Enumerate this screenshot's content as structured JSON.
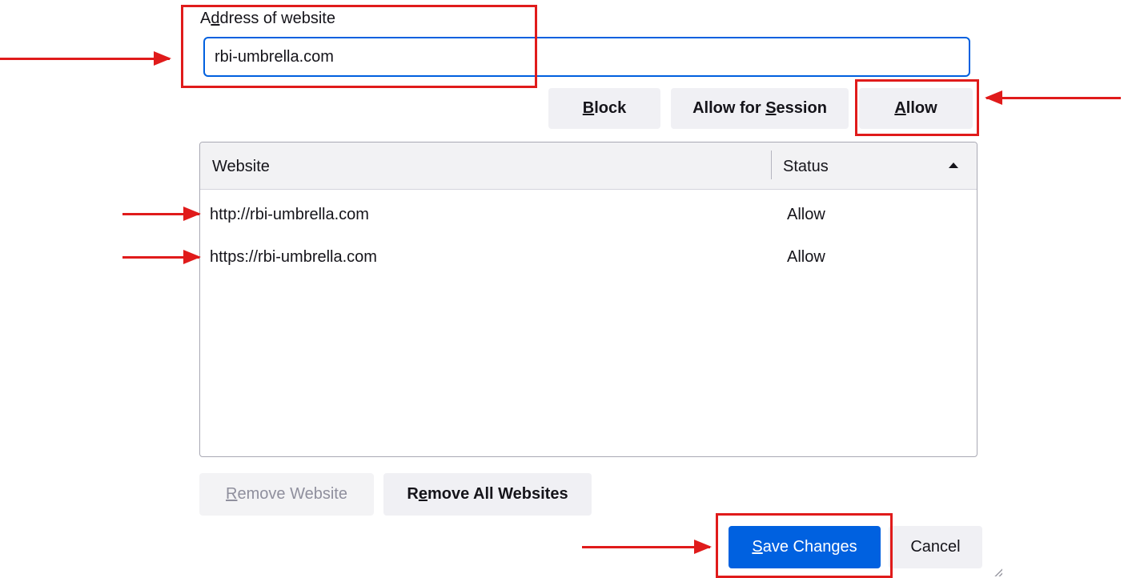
{
  "address": {
    "label_prefix": "A",
    "label_access": "d",
    "label_rest": "dress of website",
    "value": "rbi-umbrella.com"
  },
  "actions": {
    "block": {
      "access": "B",
      "rest": "lock"
    },
    "allow_session": {
      "prefix": "Allow for ",
      "access": "S",
      "rest": "ession"
    },
    "allow": {
      "access": "A",
      "rest": "llow"
    }
  },
  "table": {
    "columns": {
      "website": "Website",
      "status": "Status"
    },
    "sort_direction": "ascending",
    "rows": [
      {
        "website": "http://rbi-umbrella.com",
        "status": "Allow"
      },
      {
        "website": "https://rbi-umbrella.com",
        "status": "Allow"
      }
    ]
  },
  "remove": {
    "remove_site": {
      "access": "R",
      "rest": "emove Website"
    },
    "remove_all": {
      "prefix": "R",
      "access": "e",
      "rest": "move All Websites"
    }
  },
  "dialog": {
    "save": {
      "access": "S",
      "rest": "ave Changes"
    },
    "cancel": "Cancel"
  },
  "colors": {
    "primary": "#0061e0",
    "annotation": "#e01b1b",
    "focus_border": "#0060df"
  }
}
